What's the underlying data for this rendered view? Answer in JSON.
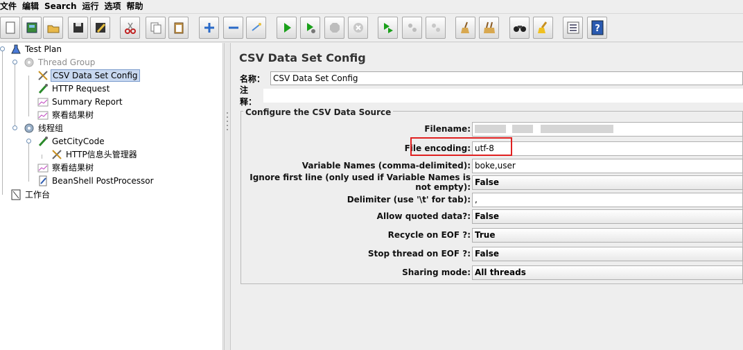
{
  "menu": [
    "文件",
    "编辑",
    "Search",
    "运行",
    "选项",
    "帮助"
  ],
  "toolbar": {
    "buttons": [
      {
        "name": "new-button",
        "icon": "new-file-icon"
      },
      {
        "name": "templates-button",
        "icon": "templates-book-icon"
      },
      {
        "name": "open-button",
        "icon": "open-folder-icon"
      },
      {
        "name": "save-button",
        "icon": "floppy-disk-icon"
      },
      {
        "name": "save-as-button",
        "icon": "save-as-pencil-icon"
      },
      {
        "name": "cut-button",
        "icon": "scissors-icon"
      },
      {
        "name": "copy-button",
        "icon": "copy-icon"
      },
      {
        "name": "paste-button",
        "icon": "clipboard-icon"
      },
      {
        "name": "expand-button",
        "icon": "plus-icon"
      },
      {
        "name": "collapse-button",
        "icon": "minus-icon"
      },
      {
        "name": "toggle-button",
        "icon": "toggle-wand-icon"
      },
      {
        "name": "start-button",
        "icon": "play-icon"
      },
      {
        "name": "start-no-pauses-button",
        "icon": "play-no-timer-icon"
      },
      {
        "name": "stop-button",
        "icon": "stop-icon"
      },
      {
        "name": "shutdown-button",
        "icon": "shutdown-icon"
      },
      {
        "name": "remote-start-button",
        "icon": "remote-start-icon"
      },
      {
        "name": "remote-stop-button",
        "icon": "remote-stop-icon"
      },
      {
        "name": "remote-shutdown-button",
        "icon": "remote-shutdown-icon"
      },
      {
        "name": "clear-button",
        "icon": "broom-icon"
      },
      {
        "name": "clear-all-button",
        "icon": "broom-all-icon"
      },
      {
        "name": "search-button",
        "icon": "binoculars-icon"
      },
      {
        "name": "reset-search-button",
        "icon": "brush-icon"
      },
      {
        "name": "function-helper-button",
        "icon": "list-icon"
      },
      {
        "name": "help-button",
        "icon": "help-icon"
      }
    ]
  },
  "tree": [
    {
      "label": "Test Plan",
      "icon": "test-plan-flask-icon",
      "state": "normal"
    },
    {
      "label": "Thread Group",
      "icon": "gear-icon",
      "state": "disabled"
    },
    {
      "label": "CSV Data Set Config",
      "icon": "wrench-screwdriver-icon",
      "state": "selected"
    },
    {
      "label": "HTTP Request",
      "icon": "pipette-icon",
      "state": "normal"
    },
    {
      "label": "Summary Report",
      "icon": "graph-icon",
      "state": "normal"
    },
    {
      "label": "察看结果树",
      "icon": "graph-icon",
      "state": "normal"
    },
    {
      "label": "线程组",
      "icon": "gear-icon",
      "state": "normal"
    },
    {
      "label": "GetCityCode",
      "icon": "pipette-icon",
      "state": "normal"
    },
    {
      "label": "HTTP信息头管理器",
      "icon": "wrench-screwdriver-icon",
      "state": "normal"
    },
    {
      "label": "察看结果树",
      "icon": "graph-icon",
      "state": "normal"
    },
    {
      "label": "BeanShell PostProcessor",
      "icon": "script-icon",
      "state": "normal"
    },
    {
      "label": "工作台",
      "icon": "workbench-icon",
      "state": "normal"
    }
  ],
  "panel": {
    "title": "CSV Data Set Config",
    "name_label": "名称：",
    "name_value": "CSV Data Set Config",
    "comment_label": "注释：",
    "group_title": "Configure the CSV Data Source",
    "fields": [
      {
        "label": "Filename:",
        "value": "",
        "kind": "text"
      },
      {
        "label": "File encoding:",
        "value": "utf-8",
        "kind": "text"
      },
      {
        "label": "Variable Names (comma-delimited):",
        "value": "boke,user",
        "kind": "text"
      },
      {
        "label": "Ignore first line (only used if Variable Names is not empty):",
        "value": "False",
        "kind": "combo"
      },
      {
        "label": "Delimiter (use '\\t' for tab):",
        "value": ",",
        "kind": "text"
      },
      {
        "label": "Allow quoted data?:",
        "value": "False",
        "kind": "combo"
      },
      {
        "label": "Recycle on EOF ?:",
        "value": "True",
        "kind": "combo"
      },
      {
        "label": "Stop thread on EOF ?:",
        "value": "False",
        "kind": "combo"
      },
      {
        "label": "Sharing mode:",
        "value": "All threads",
        "kind": "combo"
      }
    ]
  },
  "colors": {
    "highlight": "#e02020",
    "selection": "#c8d8f0"
  }
}
